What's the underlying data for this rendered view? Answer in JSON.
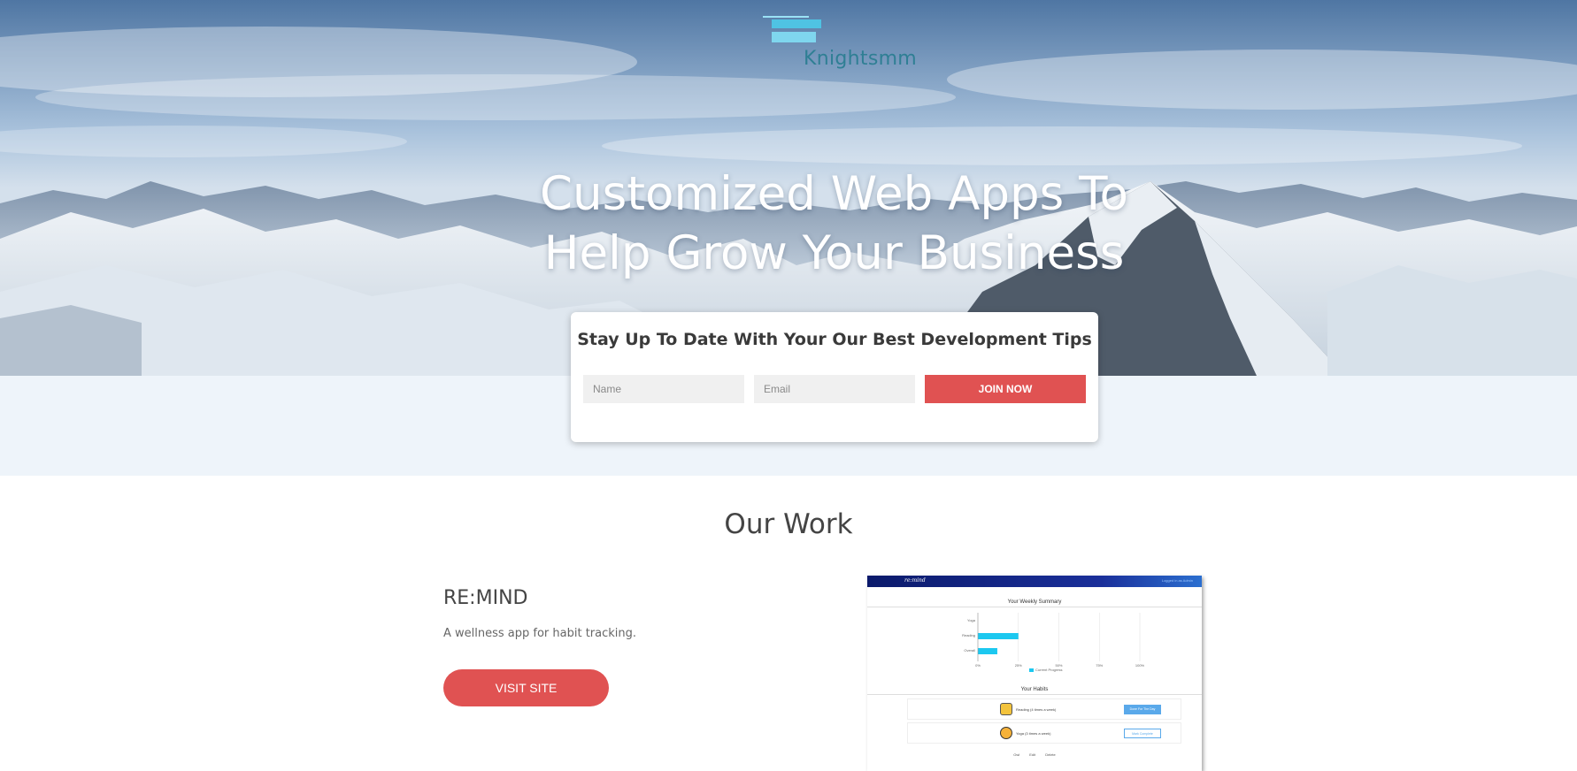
{
  "header": {
    "logo_text": "Knightsmm"
  },
  "hero": {
    "headline_line1": "Customized Web Apps To",
    "headline_line2": "Help Grow Your Business"
  },
  "signup": {
    "title": "Stay Up To Date With Your Our Best Development Tips",
    "name_placeholder": "Name",
    "email_placeholder": "Email",
    "join_label": "JOIN NOW"
  },
  "work": {
    "section_title": "Our Work",
    "project": {
      "name": "RE:MIND",
      "description": "A wellness app for habit tracking.",
      "visit_label": "VISIT SITE"
    }
  },
  "screenshot": {
    "brand": "re:mind",
    "user": "Logged in as Admin",
    "summary_title": "Your Weekly Summary",
    "chart_categories": [
      "Yoga",
      "Reading",
      "Overall"
    ],
    "chart_values": [
      0,
      25,
      12
    ],
    "chart_ticks": [
      "0%",
      "25%",
      "50%",
      "75%",
      "100%"
    ],
    "legend": "Current Progress",
    "habits_title": "Your Habits",
    "habits": [
      {
        "text": "Reading (4 times a week)",
        "button": "Done For The Day"
      },
      {
        "text": "Yoga (3 times a week)",
        "button": "Mark Complete"
      }
    ],
    "links": "Owl Edit Delete"
  },
  "colors": {
    "accent": "#e05252",
    "band": "#eef4fa",
    "logo": "#2f7f94"
  }
}
